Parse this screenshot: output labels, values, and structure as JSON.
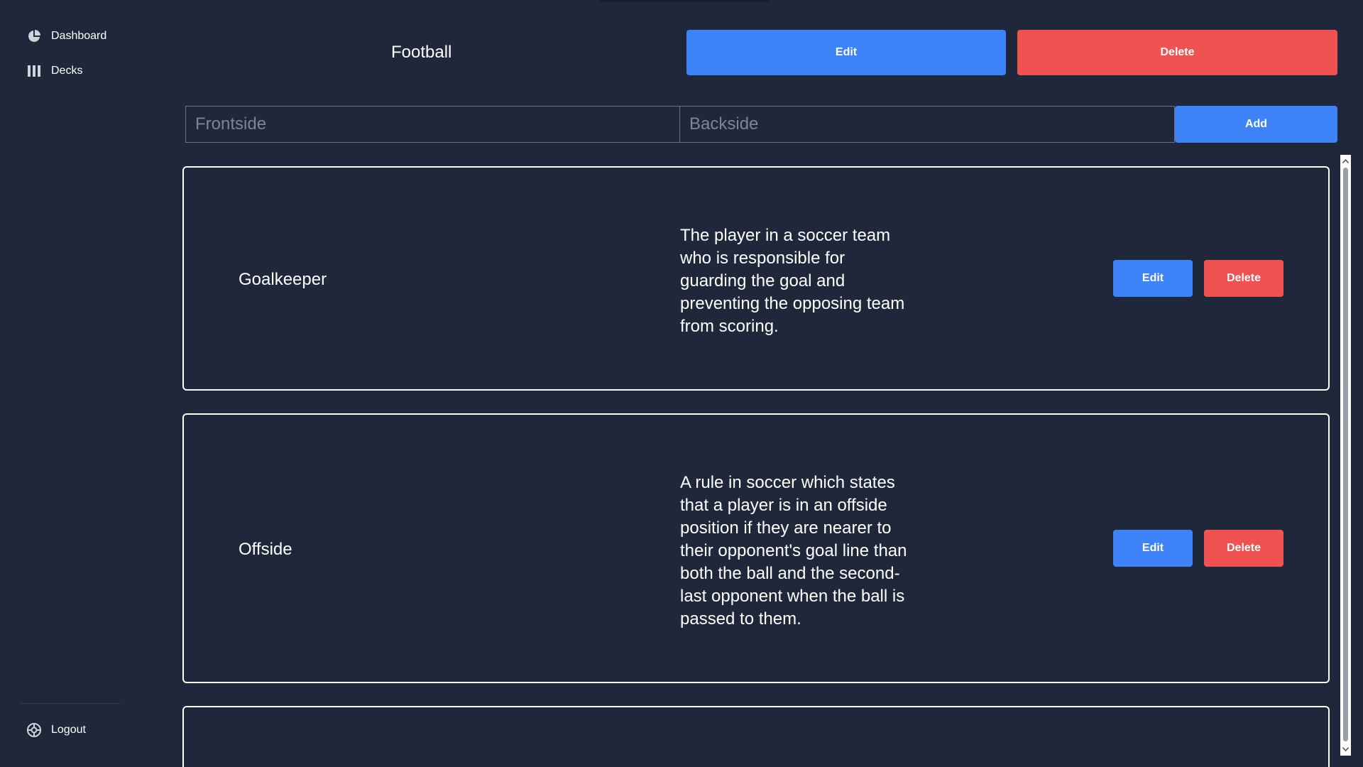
{
  "sidebar": {
    "items": [
      {
        "label": "Dashboard",
        "icon": "pie-chart-icon"
      },
      {
        "label": "Decks",
        "icon": "columns-icon"
      }
    ],
    "logout": {
      "label": "Logout",
      "icon": "gear-icon"
    }
  },
  "header": {
    "title": "Football",
    "edit_label": "Edit",
    "delete_label": "Delete"
  },
  "add_form": {
    "front_placeholder": "Frontside",
    "back_placeholder": "Backside",
    "add_label": "Add"
  },
  "cards": [
    {
      "front": "Goalkeeper",
      "back": "The player in a soccer team who is responsible for guarding the goal and preventing the opposing team from scoring.",
      "edit_label": "Edit",
      "delete_label": "Delete"
    },
    {
      "front": "Offside",
      "back": "A rule in soccer which states that a player is in an offside position if they are nearer to their opponent's goal line than both the ball and the second-last opponent when the ball is passed to them.",
      "edit_label": "Edit",
      "delete_label": "Delete"
    }
  ],
  "colors": {
    "background": "#1f283a",
    "primary": "#3f83f8",
    "danger": "#f05252",
    "text": "#ffffff"
  }
}
